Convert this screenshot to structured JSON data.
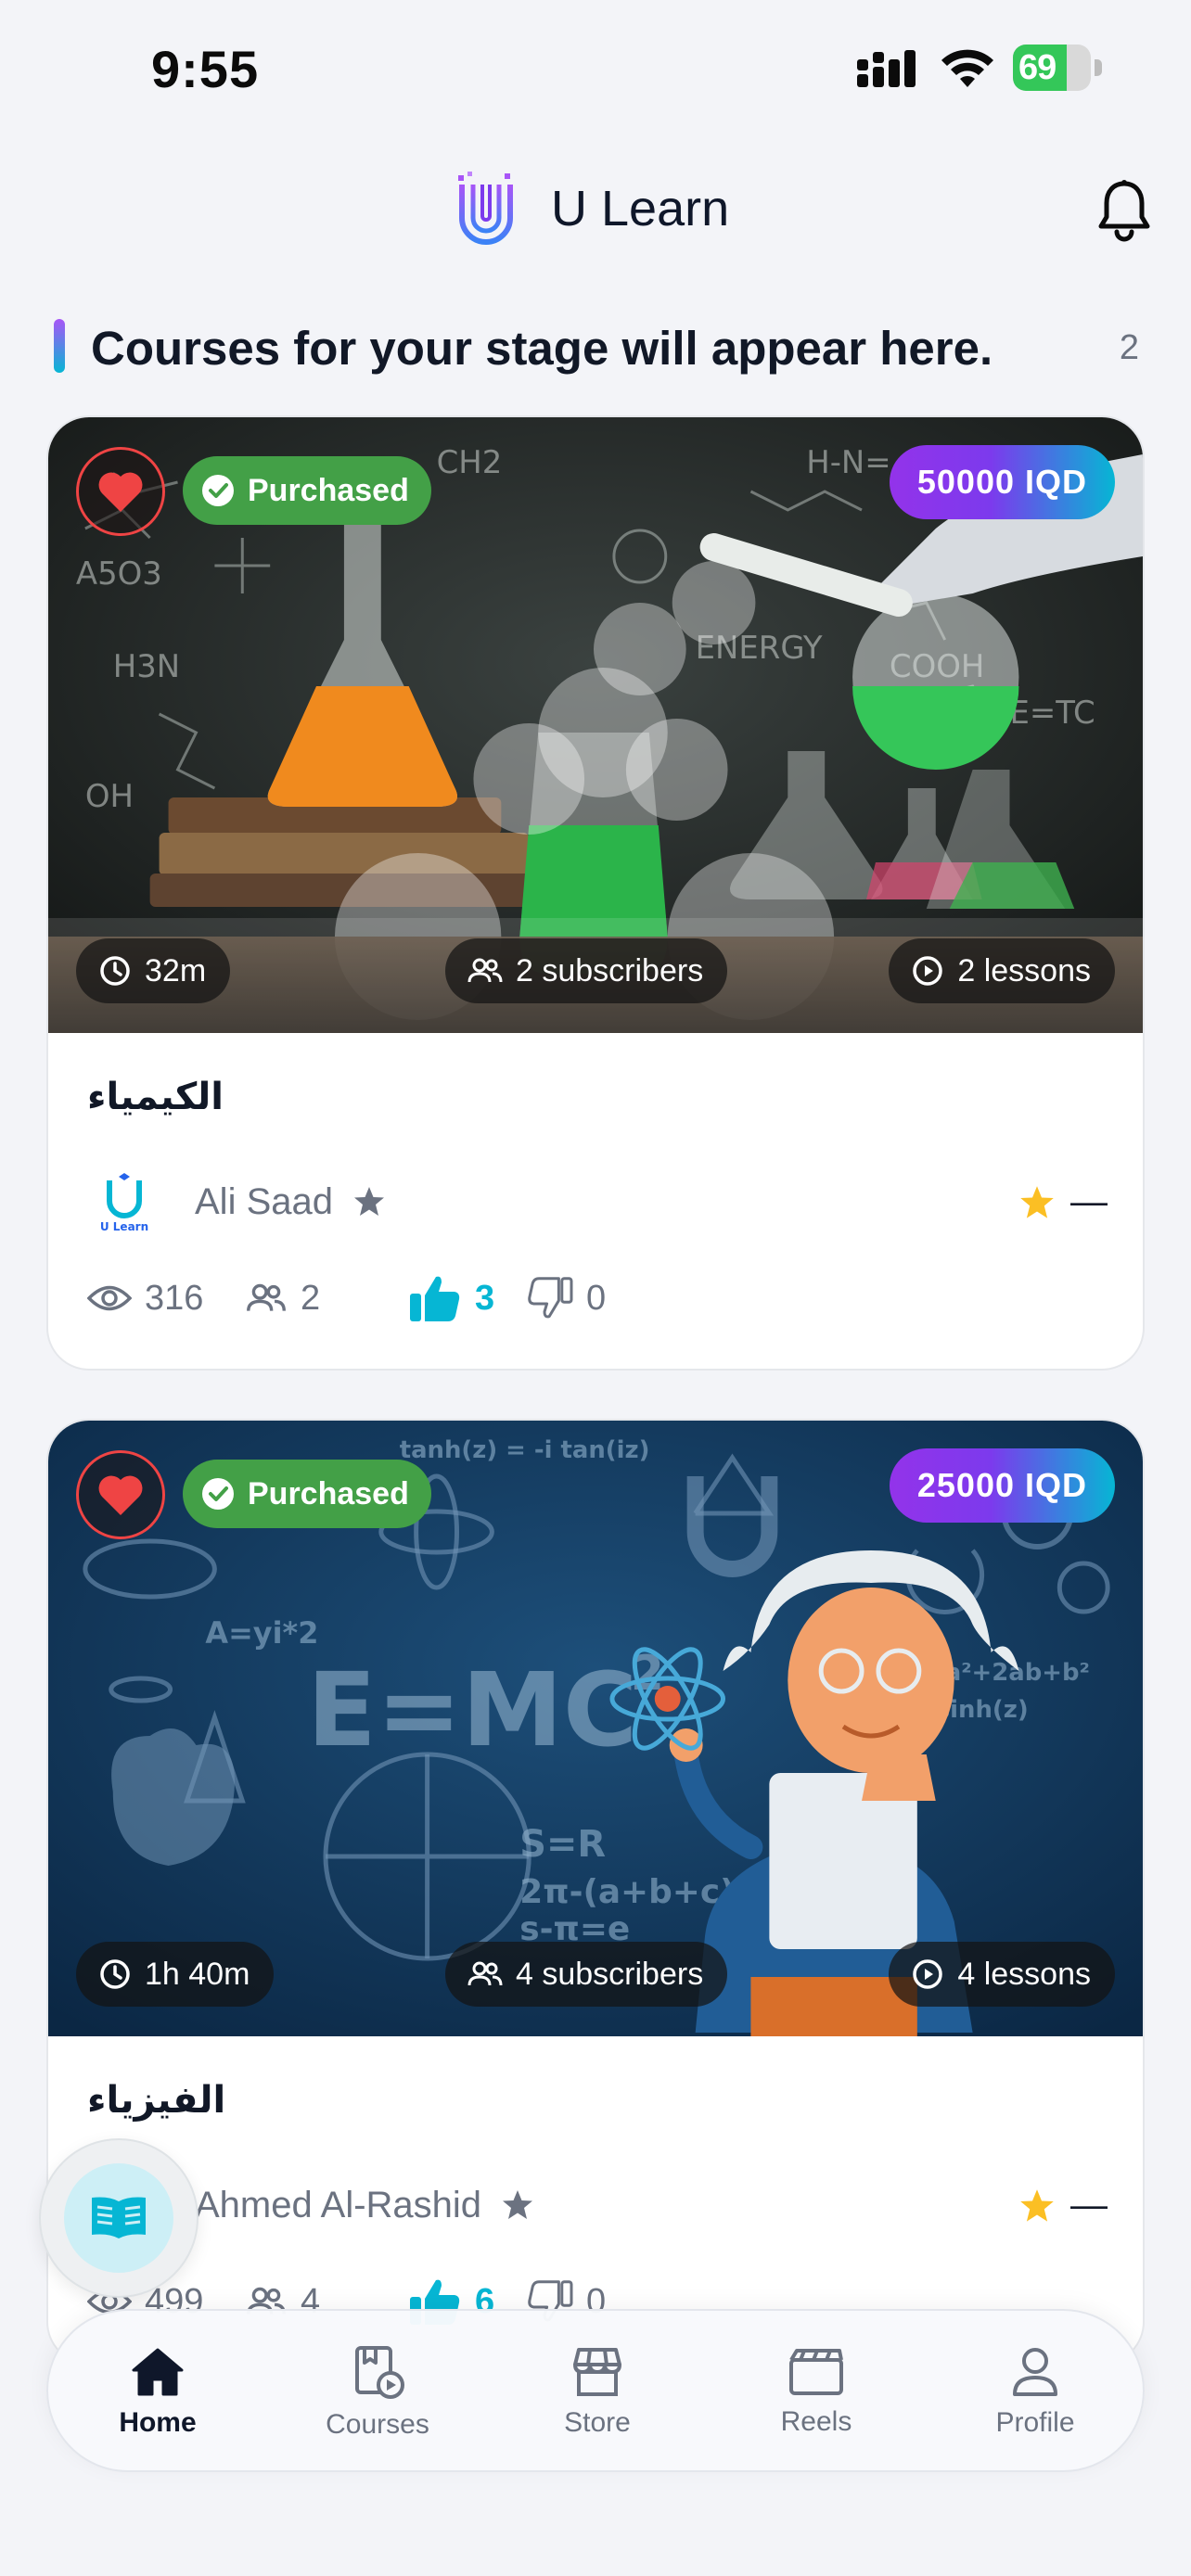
{
  "status_bar": {
    "time": "9:55",
    "battery": "69"
  },
  "header": {
    "app_name": "U Learn",
    "logo_text": "U Learn"
  },
  "section": {
    "title": "Courses for your stage will appear here.",
    "count": "2"
  },
  "courses": [
    {
      "title": "الكيمياء",
      "purchased_label": "Purchased",
      "price": "50000 IQD",
      "duration": "32m",
      "subscribers": "2 subscribers",
      "lessons": "2 lessons",
      "instructor": "Ali Saad",
      "views": "316",
      "members": "2",
      "likes": "3",
      "dislikes": "0",
      "rating": "—"
    },
    {
      "title": "الفيزياء",
      "purchased_label": "Purchased",
      "price": "25000 IQD",
      "duration": "1h 40m",
      "subscribers": "4 subscribers",
      "lessons": "4 lessons",
      "instructor": "Ahmed Al-Rashid",
      "views": "499",
      "members": "4",
      "likes": "6",
      "dislikes": "0",
      "rating": "—"
    }
  ],
  "nav": {
    "items": [
      {
        "label": "Home",
        "icon": "home-icon",
        "active": true
      },
      {
        "label": "Courses",
        "icon": "courses-icon",
        "active": false
      },
      {
        "label": "Store",
        "icon": "store-icon",
        "active": false
      },
      {
        "label": "Reels",
        "icon": "reels-icon",
        "active": false
      },
      {
        "label": "Profile",
        "icon": "profile-icon",
        "active": false
      }
    ]
  },
  "colors": {
    "accent_cyan": "#06b6d4",
    "accent_purple": "#9333ea",
    "purchased_green": "#43a047",
    "heart_red": "#ef4444",
    "star_yellow": "#fbbf24"
  }
}
